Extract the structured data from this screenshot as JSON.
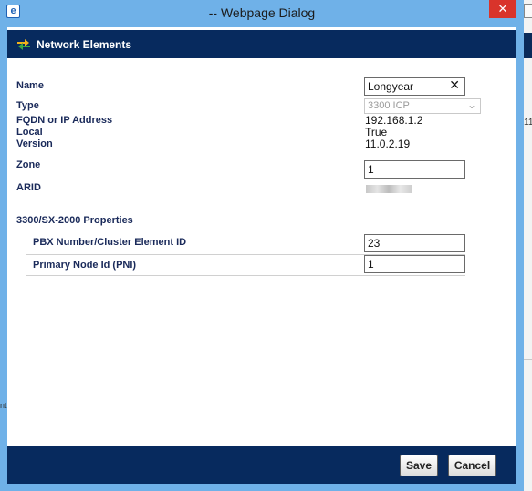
{
  "window": {
    "title": "-- Webpage Dialog",
    "app_icon": "e",
    "close_glyph": "✕"
  },
  "header": {
    "title": "Network Elements"
  },
  "fields": {
    "name": {
      "label": "Name",
      "value": "Longyear",
      "clear_glyph": "✕"
    },
    "type": {
      "label": "Type",
      "value": "3300 ICP"
    },
    "fqdn": {
      "label": "FQDN or IP Address",
      "value": "192.168.1.2"
    },
    "local": {
      "label": "Local",
      "value": "True"
    },
    "version": {
      "label": "Version",
      "value": "11.0.2.19"
    },
    "zone": {
      "label": "Zone",
      "value": "1"
    },
    "arid": {
      "label": "ARID"
    }
  },
  "properties": {
    "section_title": "3300/SX-2000 Properties",
    "pbx_number": {
      "label": "PBX Number/Cluster Element ID",
      "value": "23"
    },
    "pni": {
      "label": "Primary Node Id (PNI)",
      "value": "1"
    }
  },
  "footer": {
    "save_label": "Save",
    "cancel_label": "Cancel"
  },
  "background": {
    "right_fragment": "11",
    "left_fragment": "nt"
  },
  "colors": {
    "titlebar": "#6fb1e8",
    "band": "#072a5e",
    "close": "#d9342b"
  }
}
